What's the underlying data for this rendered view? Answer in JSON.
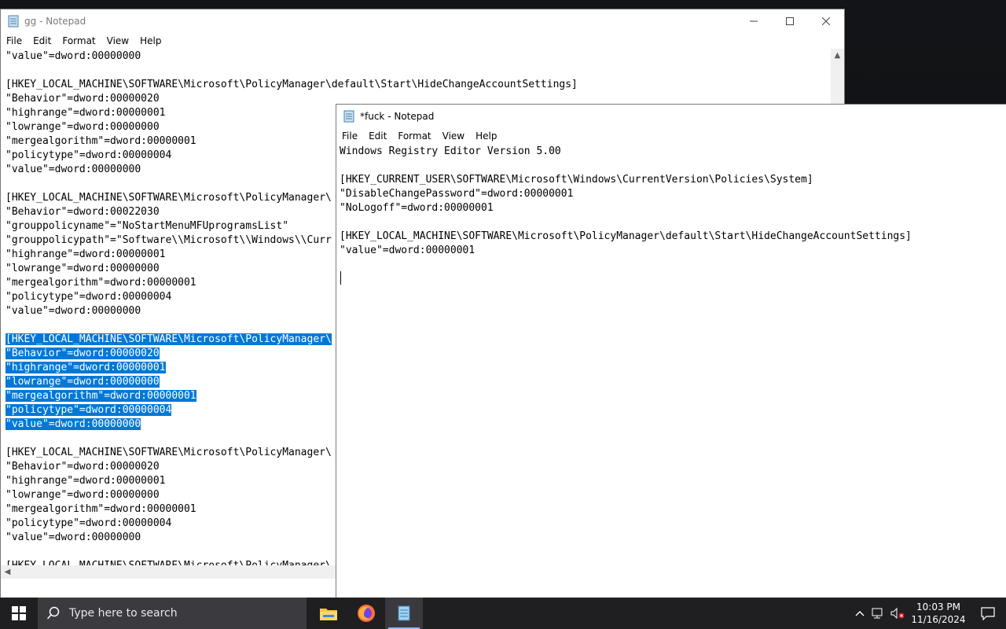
{
  "window_back": {
    "title": "gg - Notepad",
    "menu": [
      "File",
      "Edit",
      "Format",
      "View",
      "Help"
    ],
    "lines": [
      {
        "text": "\"value\"=dword:00000000",
        "selected": false
      },
      {
        "text": "",
        "selected": false
      },
      {
        "text": "[HKEY_LOCAL_MACHINE\\SOFTWARE\\Microsoft\\PolicyManager\\default\\Start\\HideChangeAccountSettings]",
        "selected": false
      },
      {
        "text": "\"Behavior\"=dword:00000020",
        "selected": false
      },
      {
        "text": "\"highrange\"=dword:00000001",
        "selected": false
      },
      {
        "text": "\"lowrange\"=dword:00000000",
        "selected": false
      },
      {
        "text": "\"mergealgorithm\"=dword:00000001",
        "selected": false
      },
      {
        "text": "\"policytype\"=dword:00000004",
        "selected": false
      },
      {
        "text": "\"value\"=dword:00000000",
        "selected": false
      },
      {
        "text": "",
        "selected": false
      },
      {
        "text": "[HKEY_LOCAL_MACHINE\\SOFTWARE\\Microsoft\\PolicyManager\\",
        "selected": false
      },
      {
        "text": "\"Behavior\"=dword:00022030",
        "selected": false
      },
      {
        "text": "\"grouppolicyname\"=\"NoStartMenuMFUprogramsList\"",
        "selected": false
      },
      {
        "text": "\"grouppolicypath\"=\"Software\\\\Microsoft\\\\Windows\\\\Curr",
        "selected": false
      },
      {
        "text": "\"highrange\"=dword:00000001",
        "selected": false
      },
      {
        "text": "\"lowrange\"=dword:00000000",
        "selected": false
      },
      {
        "text": "\"mergealgorithm\"=dword:00000001",
        "selected": false
      },
      {
        "text": "\"policytype\"=dword:00000004",
        "selected": false
      },
      {
        "text": "\"value\"=dword:00000000",
        "selected": false
      },
      {
        "text": "",
        "selected": false
      },
      {
        "text": "[HKEY_LOCAL_MACHINE\\SOFTWARE\\Microsoft\\PolicyManager\\",
        "selected": true
      },
      {
        "text": "\"Behavior\"=dword:00000020",
        "selected": true
      },
      {
        "text": "\"highrange\"=dword:00000001",
        "selected": true
      },
      {
        "text": "\"lowrange\"=dword:00000000",
        "selected": true
      },
      {
        "text": "\"mergealgorithm\"=dword:00000001",
        "selected": true
      },
      {
        "text": "\"policytype\"=dword:00000004",
        "selected": true
      },
      {
        "text": "\"value\"=dword:00000000",
        "selected": true
      },
      {
        "text": "",
        "selected": false
      },
      {
        "text": "[HKEY_LOCAL_MACHINE\\SOFTWARE\\Microsoft\\PolicyManager\\",
        "selected": false
      },
      {
        "text": "\"Behavior\"=dword:00000020",
        "selected": false
      },
      {
        "text": "\"highrange\"=dword:00000001",
        "selected": false
      },
      {
        "text": "\"lowrange\"=dword:00000000",
        "selected": false
      },
      {
        "text": "\"mergealgorithm\"=dword:00000001",
        "selected": false
      },
      {
        "text": "\"policytype\"=dword:00000004",
        "selected": false
      },
      {
        "text": "\"value\"=dword:00000000",
        "selected": false
      },
      {
        "text": "",
        "selected": false
      },
      {
        "text": "[HKEY_LOCAL_MACHINE\\SOFTWARE\\Microsoft\\PolicyManager\\",
        "selected": false
      }
    ]
  },
  "window_front": {
    "title": "*fuck - Notepad",
    "menu": [
      "File",
      "Edit",
      "Format",
      "View",
      "Help"
    ],
    "lines": [
      {
        "text": "Windows Registry Editor Version 5.00"
      },
      {
        "text": ""
      },
      {
        "text": "[HKEY_CURRENT_USER\\SOFTWARE\\Microsoft\\Windows\\CurrentVersion\\Policies\\System]"
      },
      {
        "text": "\"DisableChangePassword\"=dword:00000001"
      },
      {
        "text": "\"NoLogoff\"=dword:00000001"
      },
      {
        "text": ""
      },
      {
        "text": "[HKEY_LOCAL_MACHINE\\SOFTWARE\\Microsoft\\PolicyManager\\default\\Start\\HideChangeAccountSettings]"
      },
      {
        "text": "\"value\"=dword:00000001"
      }
    ]
  },
  "taskbar": {
    "search_placeholder": "Type here to search",
    "time": "10:03 PM",
    "date": "11/16/2024",
    "apps": [
      "file-explorer-icon",
      "firefox-icon",
      "notepad-icon"
    ]
  },
  "colors": {
    "selection": "#0078d7",
    "taskbar": "#1f1f22",
    "search_box": "#3b3b3f"
  }
}
